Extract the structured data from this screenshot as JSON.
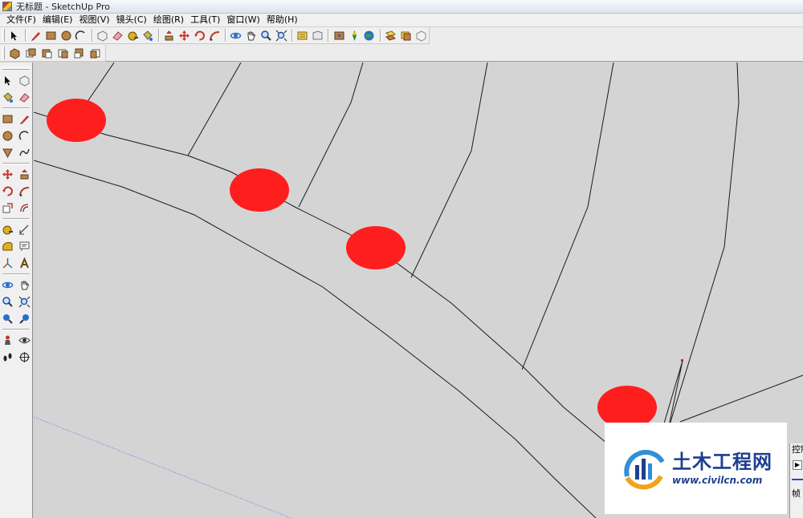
{
  "window": {
    "title": "无标题 - SketchUp Pro"
  },
  "menu": [
    "文件(F)",
    "编辑(E)",
    "视图(V)",
    "镜头(C)",
    "绘图(R)",
    "工具(T)",
    "窗口(W)",
    "帮助(H)"
  ],
  "watermark": {
    "name_cn": "土木工程网",
    "url": "www.civilcn.com"
  },
  "side_panel": {
    "title": "控制",
    "label": "帧"
  },
  "colors": {
    "marker": "#ff1e1e",
    "canvas": "#d4d4d4",
    "edge": "#1a1a1a",
    "guide": "#6a6ad8",
    "brand": "#1d3f8f"
  }
}
